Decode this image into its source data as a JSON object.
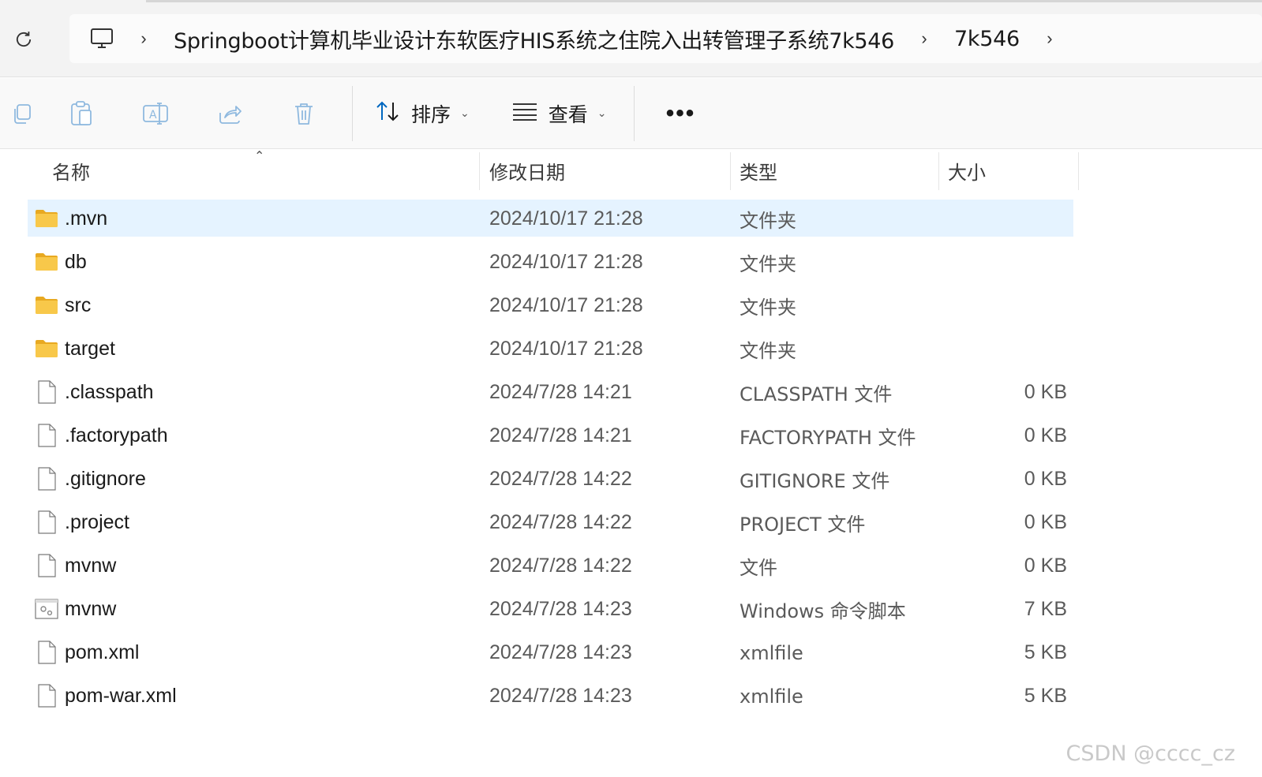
{
  "address_bar": {
    "refresh_icon": "refresh-icon",
    "computer_icon": "this-pc-icon",
    "breadcrumbs": [
      "Springboot计算机毕业设计东软医疗HIS系统之住院入出转管理子系统7k546",
      "7k546"
    ]
  },
  "toolbar": {
    "icons": [
      "copy-icon",
      "paste-icon",
      "rename-icon",
      "share-icon",
      "delete-icon"
    ],
    "sort_label": "排序",
    "view_label": "查看",
    "more_label": "•••"
  },
  "columns": {
    "name": "名称",
    "date": "修改日期",
    "type": "类型",
    "size": "大小"
  },
  "files": [
    {
      "name": ".mvn",
      "date": "2024/10/17 21:28",
      "type": "文件夹",
      "size": "",
      "icon": "folder-icon"
    },
    {
      "name": "db",
      "date": "2024/10/17 21:28",
      "type": "文件夹",
      "size": "",
      "icon": "folder-icon"
    },
    {
      "name": "src",
      "date": "2024/10/17 21:28",
      "type": "文件夹",
      "size": "",
      "icon": "folder-icon"
    },
    {
      "name": "target",
      "date": "2024/10/17 21:28",
      "type": "文件夹",
      "size": "",
      "icon": "folder-icon"
    },
    {
      "name": ".classpath",
      "date": "2024/7/28 14:21",
      "type": "CLASSPATH 文件",
      "size": "0 KB",
      "icon": "file-icon"
    },
    {
      "name": ".factorypath",
      "date": "2024/7/28 14:21",
      "type": "FACTORYPATH 文件",
      "size": "0 KB",
      "icon": "file-icon"
    },
    {
      "name": ".gitignore",
      "date": "2024/7/28 14:22",
      "type": "GITIGNORE 文件",
      "size": "0 KB",
      "icon": "file-icon"
    },
    {
      "name": ".project",
      "date": "2024/7/28 14:22",
      "type": "PROJECT 文件",
      "size": "0 KB",
      "icon": "file-icon"
    },
    {
      "name": "mvnw",
      "date": "2024/7/28 14:22",
      "type": "文件",
      "size": "0 KB",
      "icon": "file-icon"
    },
    {
      "name": "mvnw",
      "date": "2024/7/28 14:23",
      "type": "Windows 命令脚本",
      "size": "7 KB",
      "icon": "script-icon"
    },
    {
      "name": "pom.xml",
      "date": "2024/7/28 14:23",
      "type": "xmlfile",
      "size": "5 KB",
      "icon": "file-icon"
    },
    {
      "name": "pom-war.xml",
      "date": "2024/7/28 14:23",
      "type": "xmlfile",
      "size": "5 KB",
      "icon": "file-icon"
    }
  ],
  "selected_index": 0,
  "watermark": "CSDN @cccc_cz",
  "colors": {
    "selection": "#e5f3ff",
    "folder": "#f8c84a",
    "folder_dark": "#e8a921",
    "accent": "#0067c0"
  }
}
